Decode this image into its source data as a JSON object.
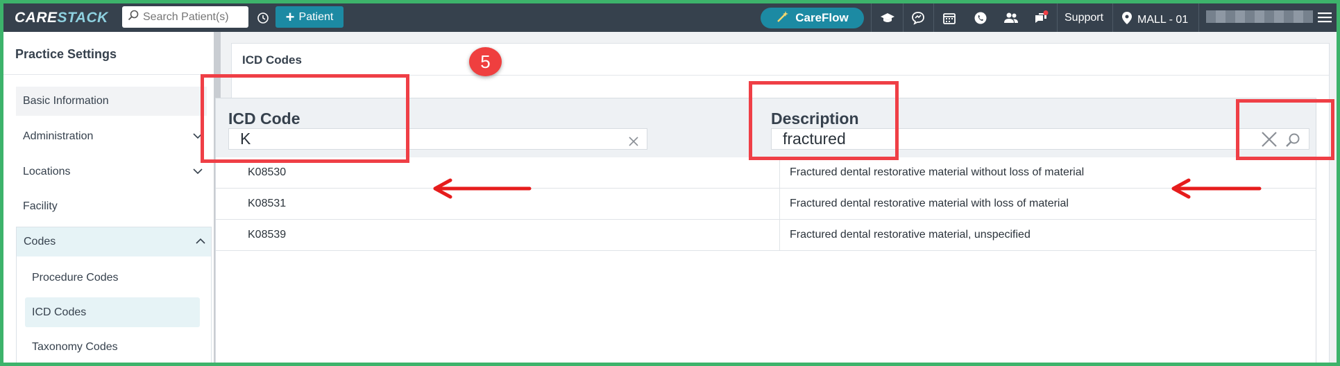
{
  "topbar": {
    "logo_left": "CARE",
    "logo_right": "STACK",
    "search_placeholder": "Search Patient(s)",
    "patient_button": "Patient",
    "careflow_button": "CareFlow",
    "support_label": "Support",
    "location_label": "MALL - 01",
    "icons": [
      "history-icon",
      "graduation-cap-icon",
      "chat-bubble-icon",
      "calendar-icon",
      "whatsapp-icon",
      "users-icon",
      "messages-icon",
      "location-pin-icon",
      "hamburger-menu-icon"
    ],
    "accent_color": "#1c8aa3",
    "bar_color": "#36414d"
  },
  "sidebar": {
    "title": "Practice Settings",
    "items": [
      {
        "label": "Basic Information"
      },
      {
        "label": "Administration"
      },
      {
        "label": "Locations"
      },
      {
        "label": "Facility"
      }
    ],
    "codes_group": {
      "label": "Codes",
      "sub_items": [
        "Procedure Codes",
        "ICD Codes",
        "Taxonomy Codes"
      ],
      "active_sub_item": "ICD Codes"
    }
  },
  "main": {
    "title": "ICD Codes",
    "step_badge": "5",
    "columns": [
      {
        "title": "ICD Code",
        "filter_value": "K"
      },
      {
        "title": "Description",
        "filter_value": "fractured"
      }
    ],
    "rows": [
      {
        "code": "K08530",
        "description": "Fractured dental restorative material without loss of material"
      },
      {
        "code": "K08531",
        "description": "Fractured dental restorative material with loss of material"
      },
      {
        "code": "K08539",
        "description": "Fractured dental restorative material, unspecified"
      }
    ]
  },
  "annotation_color": "#ef3f46"
}
